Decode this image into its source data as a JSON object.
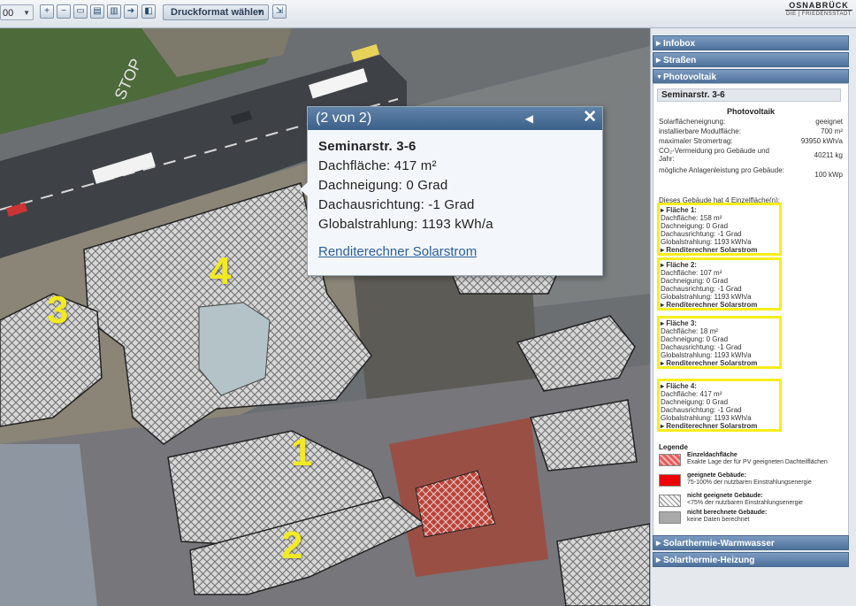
{
  "toolbar": {
    "zoom_value": "00",
    "tools": [
      {
        "icon": "zoom-in-icon",
        "glyph": "+"
      },
      {
        "icon": "zoom-out-icon",
        "glyph": "−"
      },
      {
        "icon": "map-view-icon",
        "glyph": "▭"
      },
      {
        "icon": "print-icon",
        "glyph": "▤"
      },
      {
        "icon": "table-icon",
        "glyph": "▥"
      },
      {
        "icon": "navigation-icon",
        "glyph": "➔"
      },
      {
        "icon": "layers-icon",
        "glyph": "◧"
      }
    ],
    "print_format": "Druckformat wählen",
    "export_icon": "⇲",
    "logo_brand": "OSNABRÜCK",
    "logo_sub": "DIE | FRIEDENSSTADT"
  },
  "map": {
    "labels": [
      "1",
      "2",
      "3",
      "4"
    ],
    "street_text": "STOP"
  },
  "popup": {
    "header": "(2 von 2)",
    "nav_glyph": "◀",
    "close_glyph": "✕",
    "address": "Seminarstr. 3-6",
    "dachflaeche": "Dachfläche: 417 m²",
    "dachneigung": "Dachneigung: 0 Grad",
    "dachausrichtung": "Dachausrichtung: -1 Grad",
    "globalstrahlung": "Globalstrahlung: 1193 kWh/a",
    "link": "Renditerechner Solarstrom"
  },
  "sidebar": {
    "sections": [
      "Infobox",
      "Straßen",
      "Photovoltaik",
      "Solarthermie-Warmwasser",
      "Solarthermie-Heizung"
    ],
    "address": "Seminarstr. 3-6",
    "pv_heading": "Photovoltaik",
    "rows": [
      {
        "label": "Solarflächeneignung:",
        "value": "geeignet"
      },
      {
        "label": "installierbare Modulfläche:",
        "value": "700 m²"
      },
      {
        "label": "maximaler Stromertrag:",
        "value": "93950 kWh/a"
      },
      {
        "label": "CO₂-Vermeidung pro Gebäude und Jahr:",
        "value": "40211 kg"
      },
      {
        "label": "mögliche Anlagenleistung pro Gebäude:",
        "value": "100 kWp"
      }
    ],
    "intro": "Dieses Gebäude hat 4 Einzelfläche(n):",
    "faces": [
      {
        "title": "Fläche 1:",
        "area": "Dachfläche: 158 m²",
        "tilt": "Dachneigung: 0 Grad",
        "orient": "Dachausrichtung: -1 Grad",
        "rad": "Globalstrahlung: 1193 kWh/a",
        "link": "Renditerechner Solarstrom"
      },
      {
        "title": "Fläche 2:",
        "area": "Dachfläche: 107 m²",
        "tilt": "Dachneigung: 0 Grad",
        "orient": "Dachausrichtung: -1 Grad",
        "rad": "Globalstrahlung: 1193 kWh/a",
        "link": "Renditerechner Solarstrom"
      },
      {
        "title": "Fläche 3:",
        "area": "Dachfläche: 18 m²",
        "tilt": "Dachneigung: 0 Grad",
        "orient": "Dachausrichtung: -1 Grad",
        "rad": "Globalstrahlung: 1193 kWh/a",
        "link": "Renditerechner Solarstrom"
      },
      {
        "title": "Fläche 4:",
        "area": "Dachfläche: 417 m²",
        "tilt": "Dachneigung: 0 Grad",
        "orient": "Dachausrichtung: -1 Grad",
        "rad": "Globalstrahlung: 1193 kWh/a",
        "link": "Renditerechner Solarstrom"
      }
    ],
    "legend": {
      "title": "Legende",
      "items": [
        {
          "title": "Einzeldachfläche",
          "desc": "Exakte Lage der für PV geeigneten Dachteilflächen",
          "color": "#e85a5a"
        },
        {
          "title": "geeignete Gebäude:",
          "desc": "75-100% der nutzbaren Einstrahlungsenergie",
          "color": "#ee0000"
        },
        {
          "title": "nicht geeignete Gebäude:",
          "desc": "<75% der nutzbaren Einstrahlungsenergie",
          "color": "#d8d8d8"
        },
        {
          "title": "nicht berechnete Gebäude:",
          "desc": "keine Daten berechnet",
          "color": "#a8a8a8"
        }
      ]
    }
  },
  "colors": {
    "accent": "#4d719b",
    "highlight": "#f7ee1a",
    "link": "#2b5d9a"
  }
}
